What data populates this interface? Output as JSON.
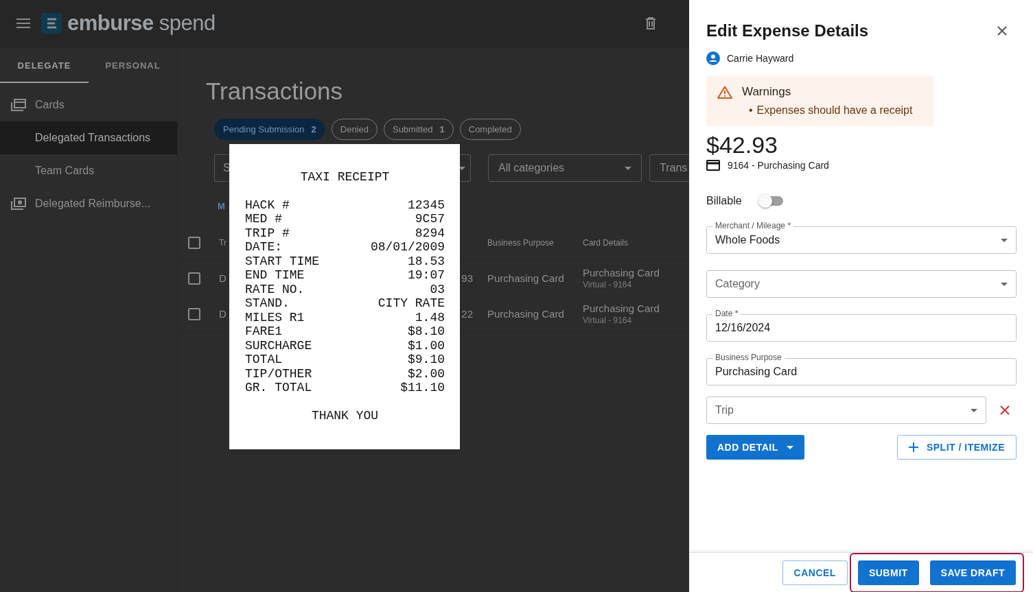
{
  "header": {
    "logo": "**emburse** spend"
  },
  "sidebar": {
    "tabs": [
      {
        "label": "DELEGATE",
        "selected": true
      },
      {
        "label": "PERSONAL",
        "selected": false
      }
    ],
    "items": [
      {
        "label": "Cards",
        "selected": false,
        "children": [
          {
            "label": "Delegated Transactions",
            "selected": true
          },
          {
            "label": "Team Cards",
            "selected": false
          }
        ]
      },
      {
        "label": "Delegated Reimburse...",
        "selected": false
      }
    ]
  },
  "main": {
    "title": "Transactions",
    "chips": [
      {
        "label": "Pending Submission",
        "count": "2",
        "selected": true
      },
      {
        "label": "Denied",
        "selected": false
      },
      {
        "label": "Submitted",
        "count": "1",
        "selected": false
      },
      {
        "label": "Completed",
        "selected": false
      }
    ],
    "filters": [
      {
        "kind": "search",
        "placeholder": "S"
      },
      {
        "kind": "select"
      },
      {
        "kind": "select",
        "placeholder": "All categories"
      },
      {
        "kind": "select",
        "placeholder": "Trans"
      }
    ],
    "link": "M",
    "table": {
      "header_checked": false,
      "columns": {
        "column_1": "Tr",
        "business_purpose": "Business Purpose",
        "card_details": "Card Details"
      },
      "rows": [
        {
          "checked": false,
          "column_1": "D",
          "amount": "93",
          "business_purpose": "Purchasing Card",
          "card": "Purchasing Card",
          "card_detail": "Virtual - 9164"
        },
        {
          "checked": false,
          "column_1": "D",
          "amount": "22",
          "business_purpose": "Purchasing Card",
          "card": "Purchasing Card",
          "card_detail": "Virtual - 9164"
        }
      ]
    }
  },
  "receipt": {
    "title": "TAXI RECEIPT",
    "lines": [
      {
        "label": "HACK #",
        "value": "12345"
      },
      {
        "label": "MED #",
        "value": "9C57"
      },
      {
        "label": "TRIP #",
        "value": "8294"
      },
      {
        "label": "DATE:",
        "value": "08/01/2009"
      },
      {
        "label": "START TIME",
        "value": "18.53"
      },
      {
        "label": "END TIME",
        "value": "19:07"
      },
      {
        "label": "RATE NO.",
        "value": "03"
      },
      {
        "label": "STAND.",
        "value": "CITY RATE"
      },
      {
        "label": "MILES R1",
        "value": "1.48"
      },
      {
        "label": "FARE1",
        "value": "$8.10"
      },
      {
        "label": "SURCHARGE",
        "value": "$1.00"
      },
      {
        "label": "TOTAL",
        "value": "$9.10"
      },
      {
        "label": "TIP/OTHER",
        "value": "$2.00"
      },
      {
        "label": "GR. TOTAL",
        "value": "$11.10"
      }
    ],
    "footer": "THANK YOU"
  },
  "drawer": {
    "title": "Edit Expense Details",
    "user": "Carrie Hayward",
    "warnings": {
      "title": "Warnings",
      "items": [
        {
          "bullet": "•",
          "text": "Expenses should have a receipt"
        }
      ]
    },
    "amount": "$42.93",
    "card": "9164 - Purchasing Card",
    "billable": {
      "label": "Billable",
      "on": false
    },
    "fields": [
      {
        "kind": "select",
        "label": "Merchant / Mileage *",
        "value": "Whole Foods"
      },
      {
        "kind": "select",
        "placeholder": "Category"
      },
      {
        "kind": "text",
        "label": "Date *",
        "value": "12/16/2024"
      },
      {
        "kind": "text",
        "label": "Business Purpose",
        "value": "Purchasing Card"
      },
      {
        "kind": "select",
        "placeholder": "Trip",
        "removable": true
      }
    ],
    "add_detail": "ADD DETAIL",
    "split": "SPLIT / ITEMIZE",
    "footer": {
      "buttons": [
        {
          "label": "CANCEL",
          "kind": "outlined"
        }
      ],
      "highlighted_buttons": [
        {
          "label": "SUBMIT",
          "kind": "primary"
        },
        {
          "label": "SAVE DRAFT",
          "kind": "primary"
        }
      ]
    }
  }
}
